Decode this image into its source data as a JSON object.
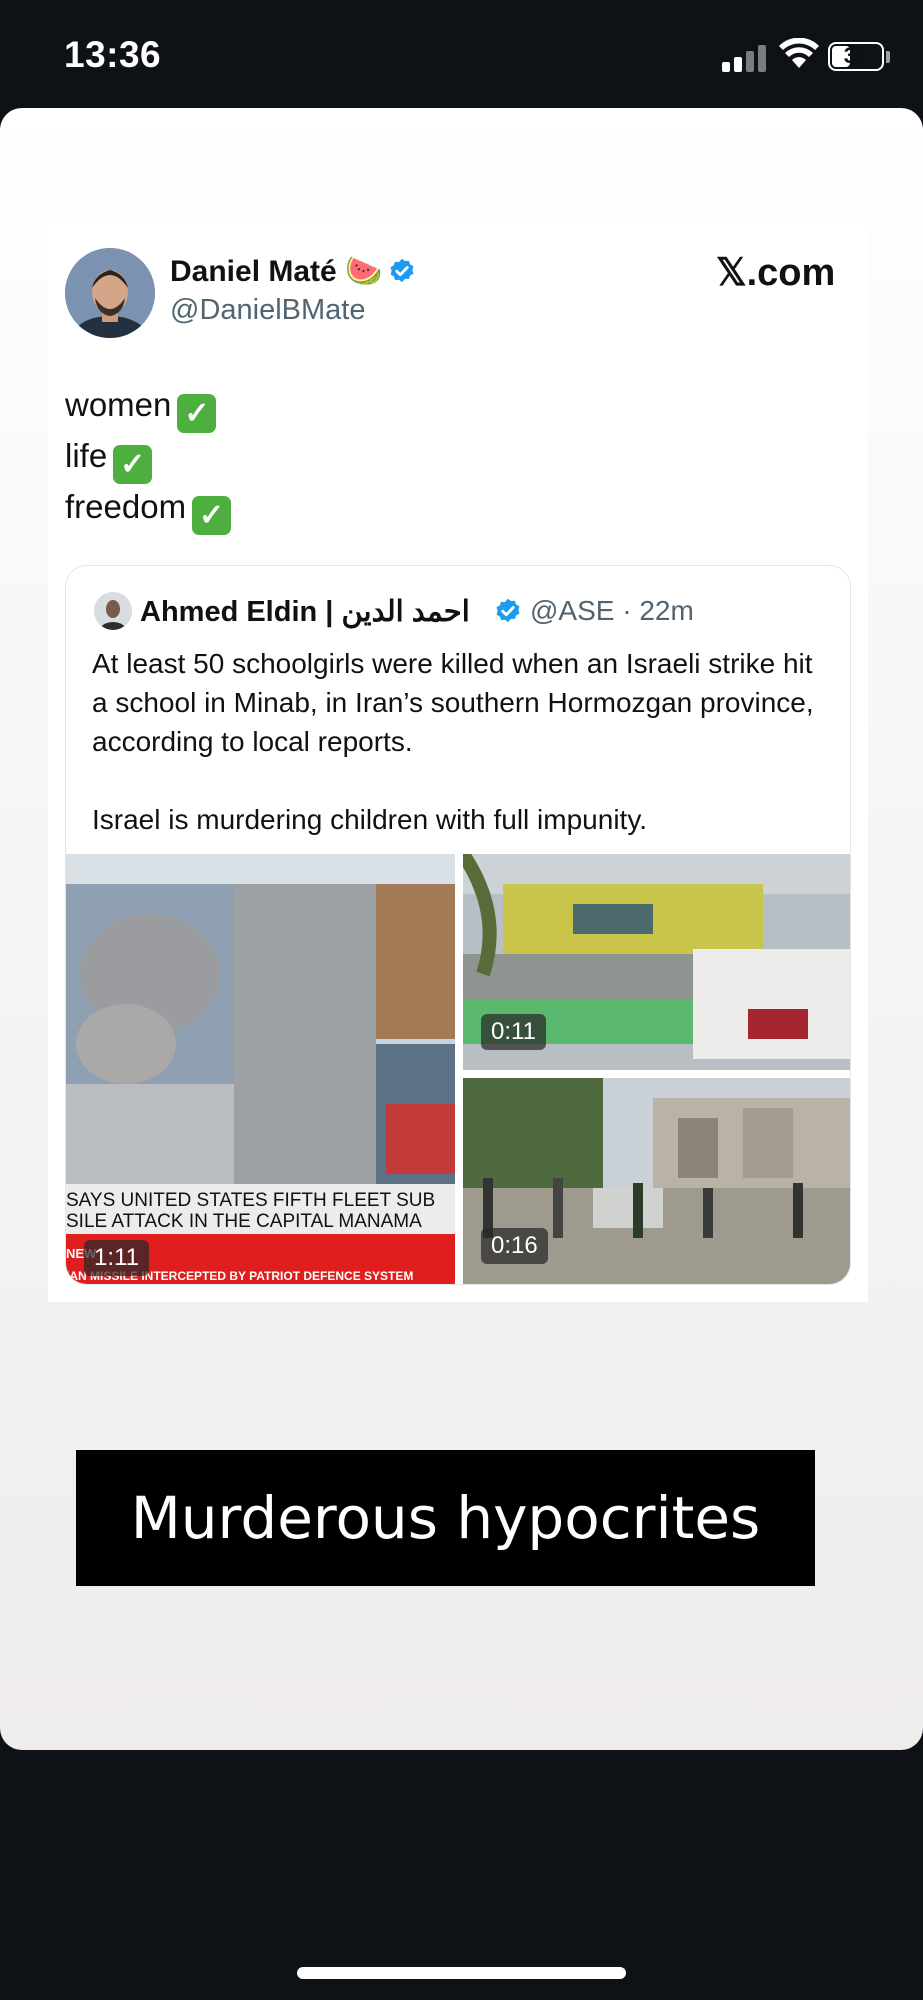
{
  "status_bar": {
    "time": "13:36",
    "battery": "39",
    "battery_level": 0.39
  },
  "post": {
    "author_name": "Daniel Maté 🍉",
    "author_handle": "@DanielBMate",
    "source": "𝕏.com",
    "lines": [
      {
        "text": "women",
        "emoji": "✓"
      },
      {
        "text": "life",
        "emoji": "✓"
      },
      {
        "text": "freedom",
        "emoji": "✓"
      }
    ]
  },
  "quoted": {
    "author_name": "Ahmed Eldin | احمد الدين",
    "handle_time": "@ASE · 22m",
    "text_1": "At least 50 schoolgirls were killed when an Israeli strike hit a school in Minab, in Iran’s southern Hormozgan province, according to local reports.",
    "text_2": "Israel is murdering children with full impunity.",
    "media": [
      {
        "duration": "1:11",
        "ticker_1": "SAYS UNITED STATES FIFTH FLEET SUB",
        "ticker_2": "SILE ATTACK IN THE CAPITAL MANAMA",
        "ticker_tag": "NEW",
        "ticker_3": "IAN MISSILE INTERCEPTED BY PATRIOT DEFENCE SYSTEM"
      },
      {
        "duration": "0:11"
      },
      {
        "duration": "0:16"
      }
    ]
  },
  "overlay_caption": "Murderous hypocrites",
  "colors": {
    "verified": "#1d9bf0",
    "check_green": "#4caf3e",
    "background": "#0e1116"
  }
}
